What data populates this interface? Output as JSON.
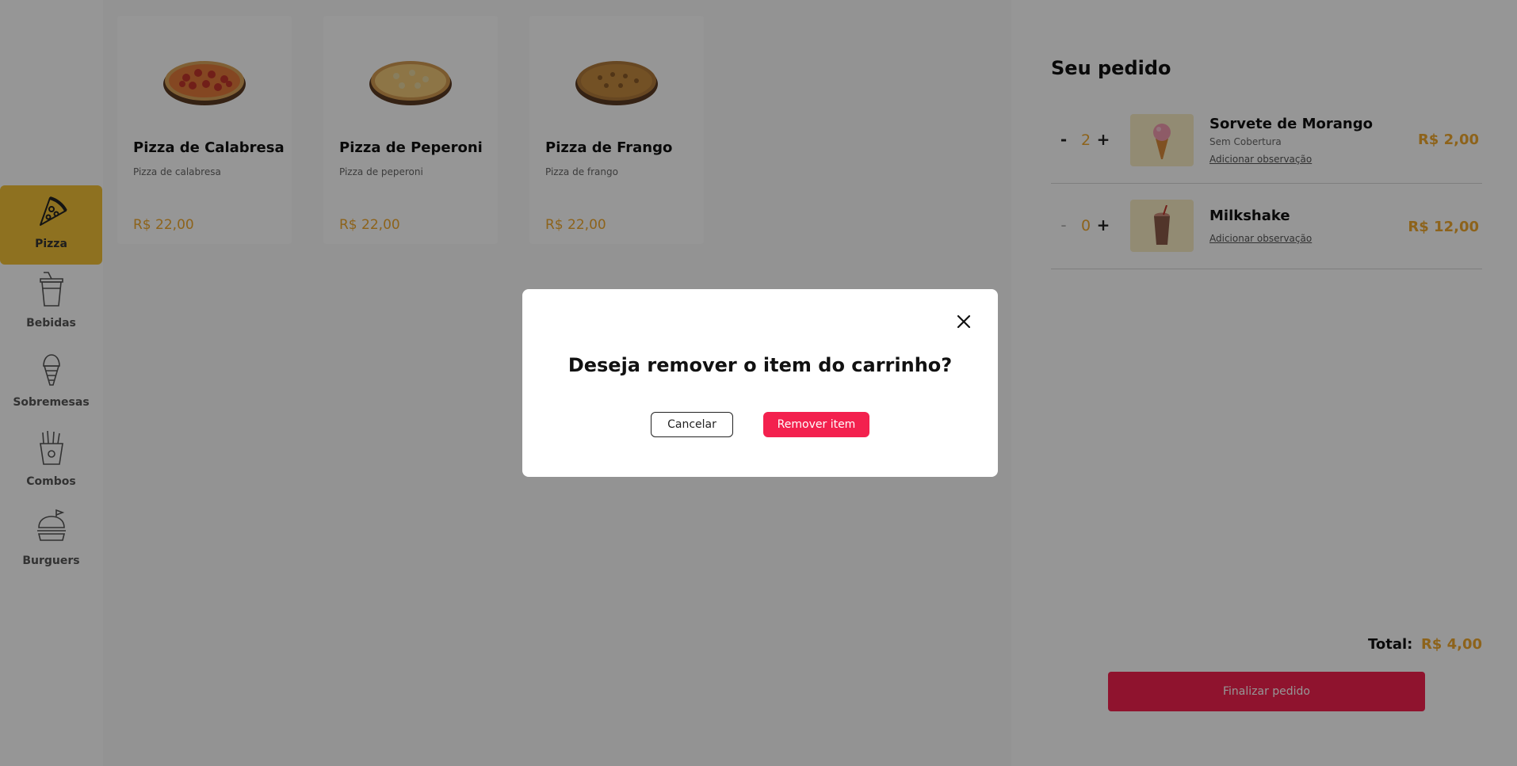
{
  "sidebar": {
    "items": [
      {
        "label": "Pizza",
        "icon": "pizza-slice-icon",
        "active": true
      },
      {
        "label": "Bebidas",
        "icon": "drink-cup-icon",
        "active": false
      },
      {
        "label": "Sobremesas",
        "icon": "ice-cream-icon",
        "active": false
      },
      {
        "label": "Combos",
        "icon": "fries-icon",
        "active": false
      },
      {
        "label": "Burguers",
        "icon": "burger-icon",
        "active": false
      }
    ]
  },
  "products": [
    {
      "name": "Pizza de Calabresa",
      "description": "Pizza de calabresa",
      "price": "R$ 22,00"
    },
    {
      "name": "Pizza de Peperoni",
      "description": "Pizza de peperoni",
      "price": "R$ 22,00"
    },
    {
      "name": "Pizza de Frango",
      "description": "Pizza de frango",
      "price": "R$ 22,00"
    }
  ],
  "order": {
    "title": "Seu pedido",
    "items": [
      {
        "minus": "-",
        "plus": "+",
        "quantity": "2",
        "name": "Sorvete de Morango",
        "subtitle": "Sem Cobertura",
        "observation_link": "Adicionar observação",
        "price": "R$ 2,00"
      },
      {
        "minus": "-",
        "plus": "+",
        "quantity": "0",
        "name": "Milkshake",
        "observation_link": "Adicionar observação",
        "price": "R$ 12,00"
      }
    ],
    "total_label": "Total:",
    "total_value": "R$ 4,00",
    "finalize_label": "Finalizar pedido"
  },
  "modal": {
    "title": "Deseja remover o item do carrinho?",
    "cancel_label": "Cancelar",
    "remove_label": "Remover item"
  },
  "colors": {
    "accent_yellow": "#f2c037",
    "price_orange": "#f0a92e",
    "primary_red": "#f3214e",
    "overlay": "rgba(0,0,0,0.41)"
  }
}
